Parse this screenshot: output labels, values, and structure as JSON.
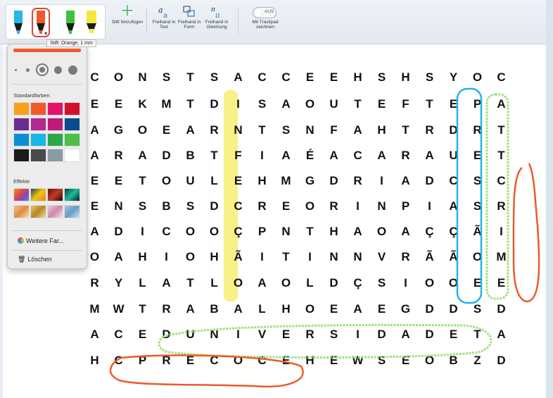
{
  "toolbar": {
    "pens": [
      {
        "name": "blue-pen",
        "color": "#29b6e8"
      },
      {
        "name": "orange-pen",
        "color": "#f05a2a"
      },
      {
        "name": "green-pen",
        "color": "#3cc23c"
      },
      {
        "name": "yellow-pen",
        "color": "#f5e83c"
      }
    ],
    "add_pen_label": "Stift hinzufügen",
    "freehand_text_label": "Freihand in Text",
    "freehand_form_label": "Freihand in Form",
    "freehand_equation_label": "Freihand in Gleichung",
    "trackpad_toggle_state": "AUS",
    "trackpad_label": "Mit Trackpad zeichnen",
    "tooltip": "Stift: Orange, 1 mm"
  },
  "pen_popover": {
    "standard_colors_label": "Standardfarben",
    "standard_colors": [
      "#f9a11b",
      "#f05a2a",
      "#e4126b",
      "#d3112b",
      "#6a2c91",
      "#b12a8f",
      "#c2177b",
      "#0b4a8f",
      "#0d8fd6",
      "#18b7e8",
      "#2aa84a",
      "#4cbf47",
      "#1a1a1a",
      "#4a4a4a",
      "#8a9aa2",
      "#ffffff"
    ],
    "effects_label": "Effekte",
    "more_colors_label": "Weitere Far...",
    "delete_label": "Löschen"
  },
  "puzzle": {
    "rows": [
      "C O N S T S A C C E E H S H S Y O C",
      "E E K M T D I S A O U T E F T E P A",
      "A G O E A R N T S N F A H T R D R T",
      "A R A D B T F I A É A C A R A U E T",
      "E E T O U L E H M G D R I A D C S C",
      "E N S B S D C R E O R I N P I A S R",
      "A D I C O O Ç P N T H A O A Ç Ç Ã I",
      "O A H I O H Ã I T I N N V R Ã Ã O M",
      "R Y L A T L O A O L D Ç S I O O E E",
      "M W T R A B A L H O E A E G D D S D",
      "A C E D U N I V E R S I D A D E T A",
      "H C P R E C O C E H E W S E O B Z D"
    ]
  }
}
